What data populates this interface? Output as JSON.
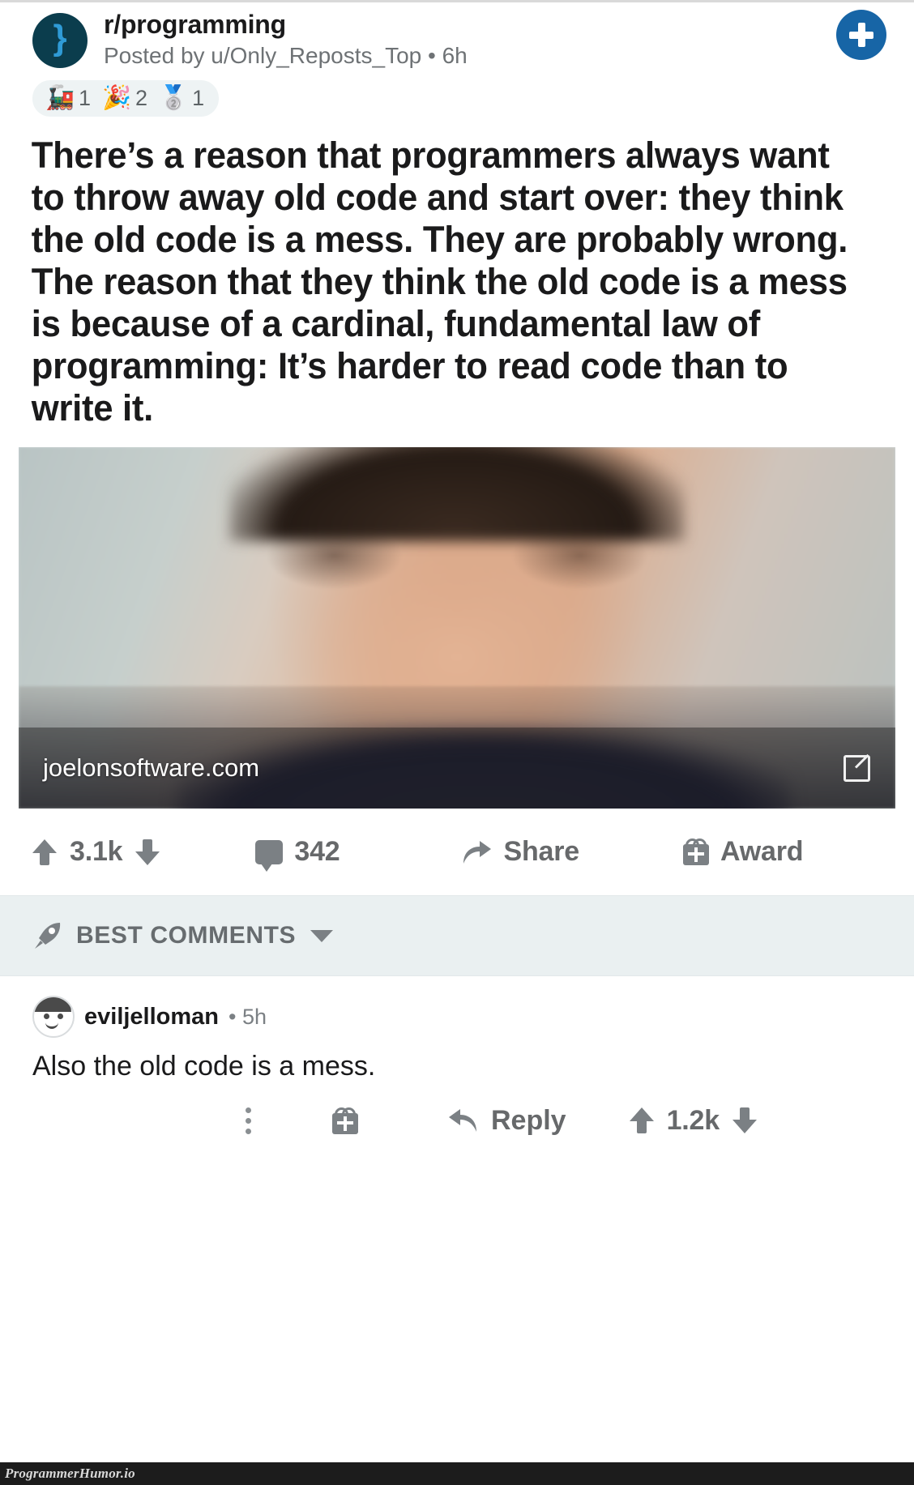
{
  "post": {
    "subreddit": "r/programming",
    "subreddit_icon": "curly-brace-icon",
    "posted_by": "Posted by u/Only_Reposts_Top • 6h",
    "join_label": "+",
    "awards": [
      {
        "icon": "reddit-train-award-icon",
        "glyph": "🚂",
        "count": "1"
      },
      {
        "icon": "rocket-like-award-icon",
        "glyph": "🎉",
        "count": "2"
      },
      {
        "icon": "silver-award-icon",
        "glyph": "🥈",
        "count": "1"
      }
    ],
    "title": "There’s a reason that programmers always want to throw away old code and start over: they think the old code is a mess. They are probably wrong. The reason that they think the old code is a mess is because of a cardinal, fundamental law of programming: It’s harder to read code than to write it.",
    "link_preview": {
      "url_label": "joelonsoftware.com",
      "external_icon": "external-link-icon"
    },
    "actions": {
      "upvote_icon": "upvote-arrow-icon",
      "score": "3.1k",
      "downvote_icon": "downvote-arrow-icon",
      "comments_icon": "comment-bubble-icon",
      "comments_count": "342",
      "share_icon": "share-arrow-icon",
      "share_label": "Share",
      "award_icon": "gift-award-icon",
      "award_label": "Award"
    }
  },
  "sort_bar": {
    "icon": "rocket-icon",
    "label": "BEST COMMENTS",
    "caret": "chevron-down-icon"
  },
  "comments": [
    {
      "avatar": "reddit-snoo-avatar",
      "author": "eviljelloman",
      "meta": "• 5h",
      "body": "Also the old code is a mess.",
      "actions": {
        "more_icon": "kebab-menu-icon",
        "award_icon": "gift-award-icon",
        "reply_icon": "reply-arrow-icon",
        "reply_label": "Reply",
        "upvote_icon": "upvote-arrow-icon",
        "score": "1.2k",
        "downvote_icon": "downvote-arrow-icon"
      }
    }
  ],
  "watermark": {
    "text": "ProgrammerHumor.io"
  },
  "colors": {
    "join_blue": "#1765a6",
    "avatar_bg": "#0b3d4d",
    "avatar_brace": "#2f9bd6",
    "sort_bar_bg": "#eaf0f1",
    "muted_text": "#6e7275",
    "icon_gray": "#7b8084",
    "watermark_bg": "#1c1c1c"
  }
}
